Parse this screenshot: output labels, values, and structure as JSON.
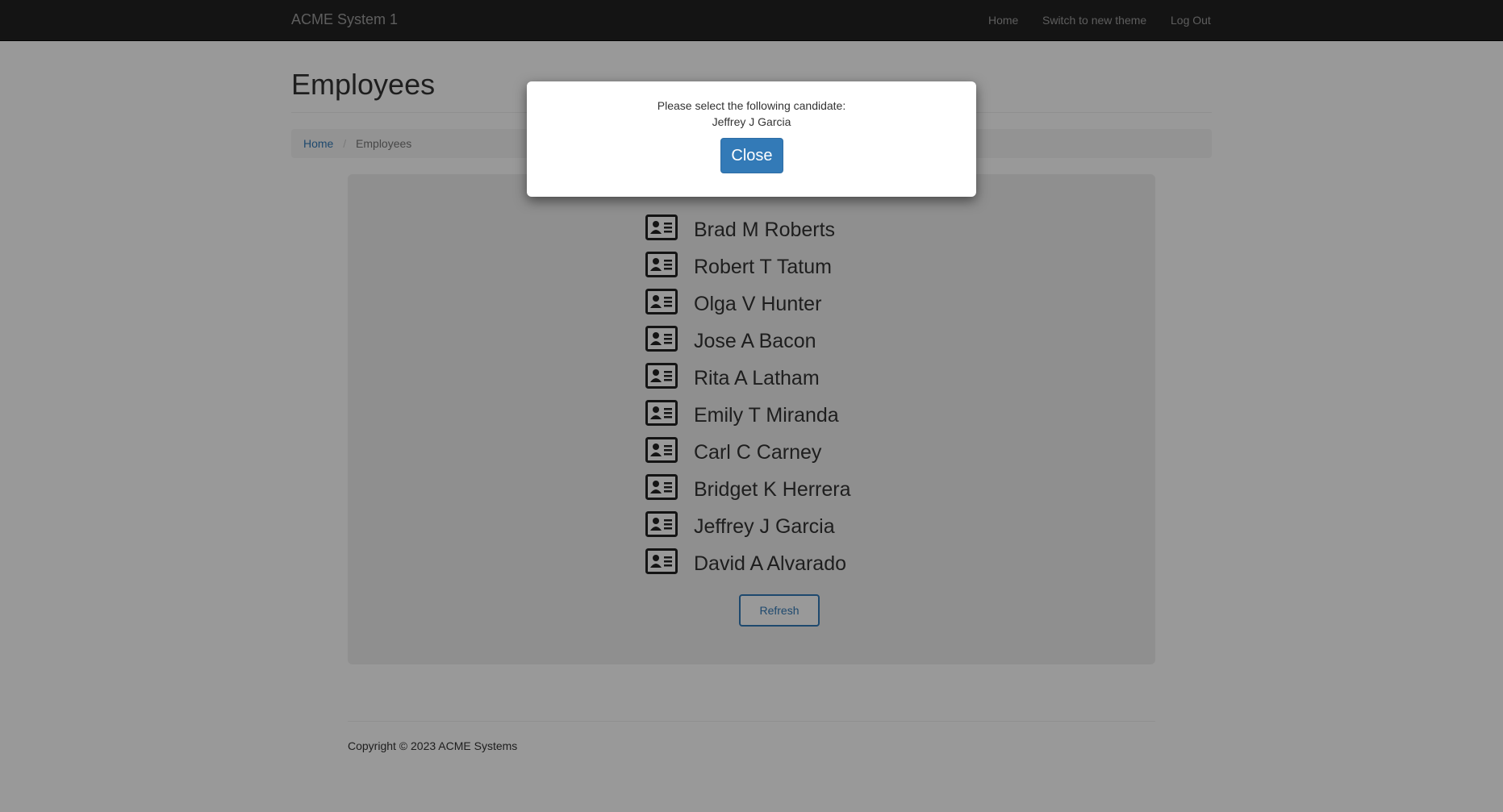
{
  "navbar": {
    "brand": "ACME System 1",
    "links": [
      "Home",
      "Switch to new theme",
      "Log Out"
    ]
  },
  "page": {
    "title": "Employees",
    "breadcrumb": {
      "home": "Home",
      "separator": "/",
      "current": "Employees"
    }
  },
  "employees": [
    "Brad M Roberts",
    "Robert T Tatum",
    "Olga V Hunter",
    "Jose A Bacon",
    "Rita A Latham",
    "Emily T Miranda",
    "Carl C Carney",
    "Bridget K Herrera",
    "Jeffrey J Garcia",
    "David A Alvarado"
  ],
  "employee_icon": "id-card-icon",
  "refresh_label": "Refresh",
  "footer": {
    "copyright": "Copyright © 2023 ACME Systems"
  },
  "modal": {
    "message": "Please select the following candidate:",
    "candidate": "Jeffrey J Garcia",
    "close_label": "Close"
  },
  "colors": {
    "navbar": "#222222",
    "accent": "#337ab7",
    "panel": "#eeeeee"
  }
}
